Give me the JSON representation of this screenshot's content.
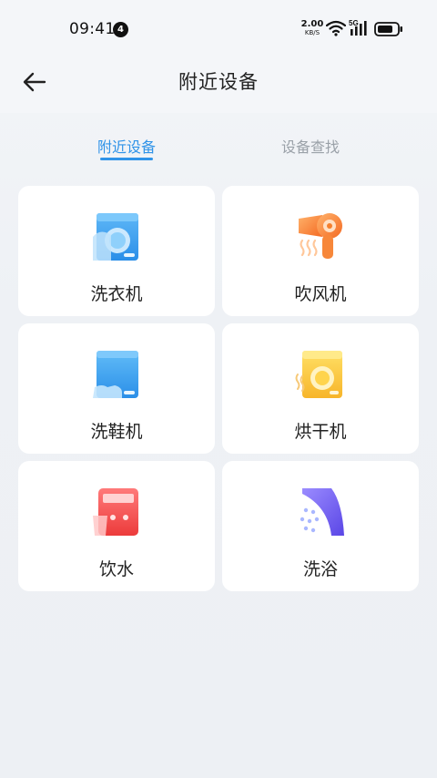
{
  "status_bar": {
    "time": "09:41",
    "notification_count": "4",
    "net_speed_value": "2.00",
    "net_speed_unit": "KB/S",
    "network_type": "5G"
  },
  "header": {
    "title": "附近设备",
    "back_icon": "arrow-left-icon"
  },
  "tabs": [
    {
      "label": "附近设备",
      "active": true
    },
    {
      "label": "设备查找",
      "active": false
    }
  ],
  "devices": [
    {
      "label": "洗衣机",
      "icon": "washing-machine-icon"
    },
    {
      "label": "吹风机",
      "icon": "hair-dryer-icon"
    },
    {
      "label": "洗鞋机",
      "icon": "shoe-washer-icon"
    },
    {
      "label": "烘干机",
      "icon": "dryer-icon"
    },
    {
      "label": "饮水",
      "icon": "water-dispenser-icon"
    },
    {
      "label": "洗浴",
      "icon": "shower-icon"
    }
  ],
  "colors": {
    "accent": "#2f93e8",
    "tab_inactive": "#9aa1a8",
    "card_bg": "#ffffff"
  }
}
